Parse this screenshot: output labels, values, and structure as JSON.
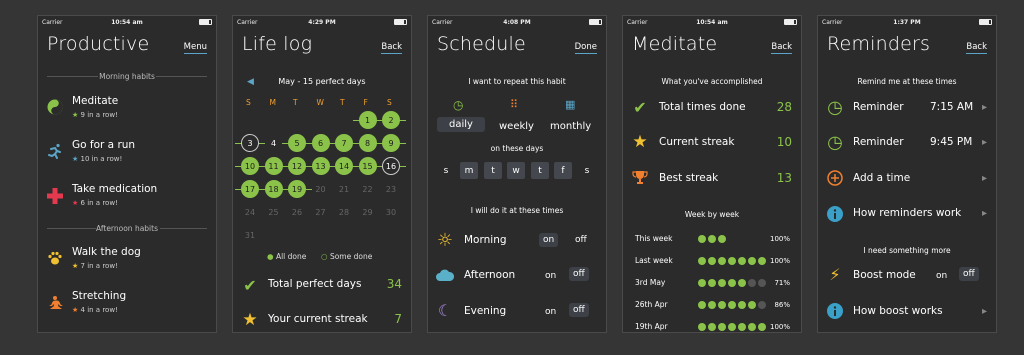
{
  "colors": {
    "green": "#8bc34a",
    "blue": "#5aa5c8",
    "red": "#e53950",
    "orange": "#f0a030",
    "bg": "#2b2b2b"
  },
  "productive": {
    "status": {
      "carrier": "Carrier",
      "time": "10:54 am"
    },
    "title": "Productive",
    "menu": "Menu",
    "morning_header": "Morning habits",
    "afternoon_header": "Afternoon habits",
    "habits": [
      {
        "name": "Meditate",
        "streak": "9 in a row!",
        "icon": "yin-yang-icon",
        "color": "#8bc34a"
      },
      {
        "name": "Go for a run",
        "streak": "10 in a row!",
        "icon": "runner-icon",
        "color": "#5aa5c8"
      },
      {
        "name": "Take medication",
        "streak": "6 in a row!",
        "icon": "medical-cross-icon",
        "color": "#e53950"
      },
      {
        "name": "Walk the dog",
        "streak": "7 in a row!",
        "icon": "paw-icon",
        "color": "#f0c030"
      },
      {
        "name": "Stretching",
        "streak": "4 in a row!",
        "icon": "yoga-icon",
        "color": "#f08030"
      }
    ]
  },
  "lifelog": {
    "status": {
      "carrier": "Carrier",
      "time": "4:29 PM"
    },
    "title": "Life log",
    "back": "Back",
    "month_label": "May - 15 perfect days",
    "weekdays": [
      "S",
      "M",
      "T",
      "W",
      "T",
      "F",
      "S"
    ],
    "calendar": [
      [
        "",
        "",
        "",
        "",
        "",
        "1",
        "2"
      ],
      [
        "3",
        "4",
        "5",
        "6",
        "7",
        "8",
        "9"
      ],
      [
        "10",
        "11",
        "12",
        "13",
        "14",
        "15",
        "16"
      ],
      [
        "17",
        "18",
        "19",
        "20",
        "21",
        "22",
        "23"
      ],
      [
        "24",
        "25",
        "26",
        "27",
        "28",
        "29",
        "30"
      ],
      [
        "31",
        "",
        "",
        "",
        "",
        "",
        ""
      ]
    ],
    "legend_done": "All done",
    "legend_some": "Some done",
    "stats": [
      {
        "label": "Total perfect days",
        "value": "34",
        "icon": "checkmark-icon"
      },
      {
        "label": "Your current streak",
        "value": "7",
        "icon": "star-icon"
      }
    ]
  },
  "schedule": {
    "status": {
      "carrier": "Carrier",
      "time": "4:08 PM"
    },
    "title": "Schedule",
    "done": "Done",
    "repeat_label": "I want to repeat this habit",
    "frequencies": [
      "daily",
      "weekly",
      "monthly"
    ],
    "days_label": "on these days",
    "days": [
      "s",
      "m",
      "t",
      "w",
      "t",
      "f",
      "s"
    ],
    "times_label": "I will do it at these times",
    "times": [
      {
        "name": "Morning",
        "on": "on",
        "off": "off",
        "state": "on"
      },
      {
        "name": "Afternoon",
        "on": "on",
        "off": "off",
        "state": "off"
      },
      {
        "name": "Evening",
        "on": "on",
        "off": "off",
        "state": "off"
      }
    ]
  },
  "meditate": {
    "status": {
      "carrier": "Carrier",
      "time": "10:54 am"
    },
    "title": "Meditate",
    "back": "Back",
    "accomplished_label": "What you've accomplished",
    "stats": [
      {
        "label": "Total times done",
        "value": "28",
        "icon": "checkmark-icon"
      },
      {
        "label": "Current streak",
        "value": "10",
        "icon": "star-icon"
      },
      {
        "label": "Best streak",
        "value": "13",
        "icon": "trophy-icon"
      }
    ],
    "week_label": "Week by week",
    "weeks": [
      {
        "name": "This week",
        "done": 3,
        "total": 3,
        "pct": "100%"
      },
      {
        "name": "Last week",
        "done": 7,
        "total": 7,
        "pct": "100%"
      },
      {
        "name": "3rd May",
        "done": 5,
        "total": 7,
        "pct": "71%"
      },
      {
        "name": "26th Apr",
        "done": 6,
        "total": 7,
        "pct": "86%"
      },
      {
        "name": "19th Apr",
        "done": 7,
        "total": 7,
        "pct": "100%"
      }
    ]
  },
  "reminders": {
    "status": {
      "carrier": "Carrier",
      "time": "1:37 PM"
    },
    "title": "Reminders",
    "back": "Back",
    "remind_label": "Remind me at these times",
    "items": [
      {
        "label": "Reminder",
        "value": "7:15 AM"
      },
      {
        "label": "Reminder",
        "value": "9:45 PM"
      },
      {
        "label": "Add a time",
        "value": ""
      },
      {
        "label": "How reminders work",
        "value": ""
      }
    ],
    "more_label": "I need something more",
    "boost": {
      "label": "Boost mode",
      "on": "on",
      "off": "off"
    },
    "boost_help": "How boost works"
  }
}
